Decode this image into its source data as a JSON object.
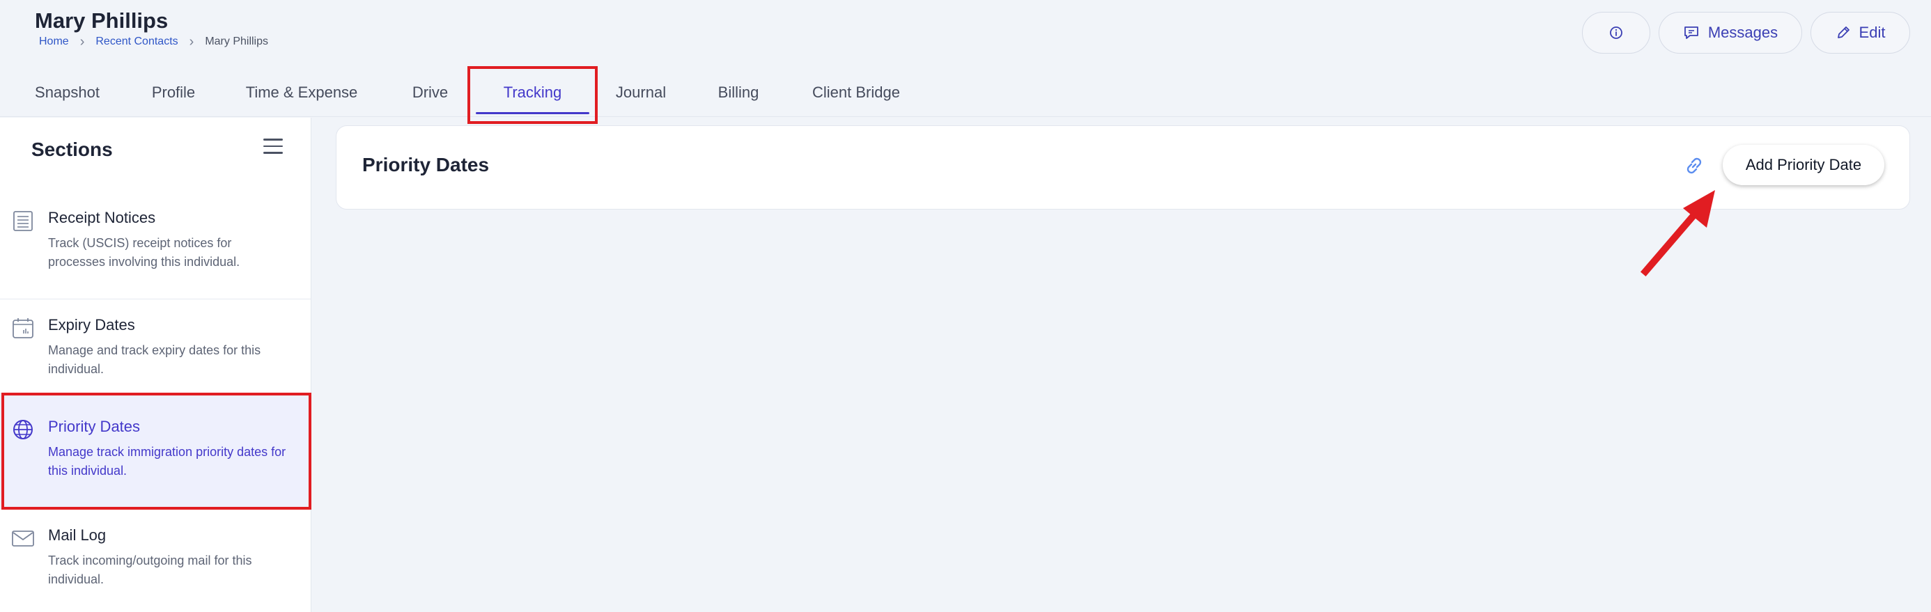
{
  "header": {
    "contact_name": "Mary Phillips",
    "breadcrumb": {
      "home": "Home",
      "recent_contacts": "Recent Contacts",
      "current": "Mary Phillips",
      "separator": "›"
    },
    "actions": {
      "info_icon": "info-icon",
      "messages_label": "Messages",
      "messages_icon": "message-icon",
      "edit_label": "Edit",
      "edit_icon": "pencil-icon"
    }
  },
  "tabs": [
    {
      "label": "Snapshot"
    },
    {
      "label": "Profile"
    },
    {
      "label": "Time & Expense"
    },
    {
      "label": "Drive"
    },
    {
      "label": "Tracking",
      "active": true
    },
    {
      "label": "Journal"
    },
    {
      "label": "Billing"
    },
    {
      "label": "Client Bridge"
    }
  ],
  "sidebar": {
    "title": "Sections",
    "menu_icon": "hamburger-icon",
    "items": [
      {
        "label": "Receipt Notices",
        "description": "Track (USCIS) receipt notices for processes involving this individual.",
        "icon": "document-list-icon"
      },
      {
        "label": "Expiry Dates",
        "description": "Manage and track expiry dates for this individual.",
        "icon": "calendar-icon"
      },
      {
        "label": "Priority Dates",
        "description": "Manage track immigration priority dates for this individual.",
        "icon": "globe-icon",
        "active": true
      },
      {
        "label": "Mail Log",
        "description": "Track incoming/outgoing mail for this individual.",
        "icon": "envelope-icon"
      }
    ]
  },
  "main": {
    "title": "Priority Dates",
    "link_icon": "link-icon",
    "add_button_label": "Add Priority Date"
  },
  "colors": {
    "accent": "#4338ca",
    "highlight": "#e11d22",
    "background": "#f1f4f9"
  }
}
